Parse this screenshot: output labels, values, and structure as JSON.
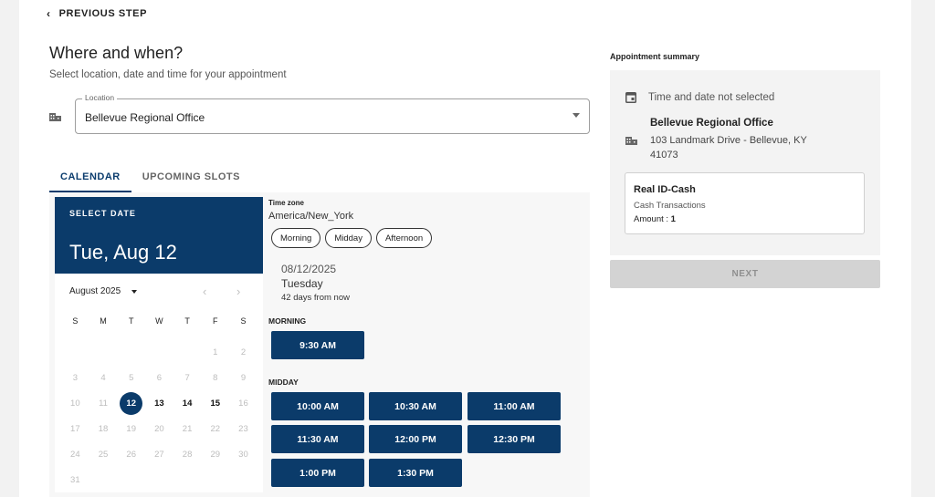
{
  "nav": {
    "previous_step": "PREVIOUS STEP"
  },
  "header": {
    "title": "Where and when?",
    "subtitle": "Select location, date and time for your appointment"
  },
  "location": {
    "legend": "Location",
    "value": "Bellevue Regional Office"
  },
  "tabs": [
    {
      "label": "CALENDAR",
      "active": true
    },
    {
      "label": "UPCOMING SLOTS",
      "active": false
    }
  ],
  "calendar": {
    "select_label": "SELECT DATE",
    "selected_display": "Tue, Aug 12",
    "month_label": "August 2025",
    "weekdays": [
      "S",
      "M",
      "T",
      "W",
      "T",
      "F",
      "S"
    ],
    "leading_blanks": 5,
    "days": [
      "1",
      "2",
      "3",
      "4",
      "5",
      "6",
      "7",
      "8",
      "9",
      "10",
      "11",
      "12",
      "13",
      "14",
      "15",
      "16",
      "17",
      "18",
      "19",
      "20",
      "21",
      "22",
      "23",
      "24",
      "25",
      "26",
      "27",
      "28",
      "29",
      "30",
      "31"
    ],
    "available": [
      "12",
      "13",
      "14",
      "15"
    ],
    "selected": "12"
  },
  "slots": {
    "timezone_label": "Time zone",
    "timezone": "America/New_York",
    "filters": [
      "Morning",
      "Midday",
      "Afternoon"
    ],
    "date": "08/12/2025",
    "weekday": "Tuesday",
    "relative": "42 days from now",
    "sections": [
      {
        "label": "MORNING",
        "times": [
          "9:30 AM"
        ]
      },
      {
        "label": "MIDDAY",
        "times": [
          "10:00 AM",
          "10:30 AM",
          "11:00 AM",
          "11:30 AM",
          "12:00 PM",
          "12:30 PM",
          "1:00 PM",
          "1:30 PM"
        ]
      }
    ]
  },
  "summary": {
    "title": "Appointment summary",
    "time_status": "Time and date not selected",
    "office_name": "Bellevue Regional Office",
    "office_address": "103 Landmark Drive - Bellevue, KY 41073",
    "service_name": "Real ID-Cash",
    "service_desc": "Cash Transactions",
    "amount_label": "Amount :",
    "amount_value": "1"
  },
  "actions": {
    "next": "NEXT"
  },
  "colors": {
    "primary": "#0b3b6a",
    "disabled": "#d3d3d3"
  },
  "icons": [
    "chevron-left-icon",
    "building-icon",
    "dropdown-arrow-icon",
    "calendar-icon",
    "chevron-right-icon"
  ]
}
